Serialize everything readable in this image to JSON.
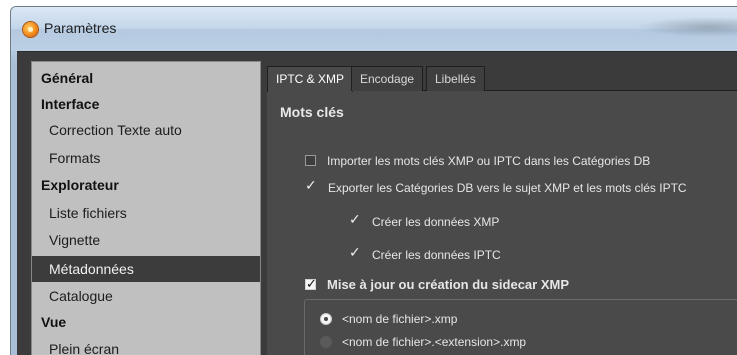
{
  "window": {
    "title": "Paramètres"
  },
  "nav": {
    "items": [
      {
        "label": "Général",
        "type": "head"
      },
      {
        "label": "Interface",
        "type": "head"
      },
      {
        "label": "Correction Texte auto",
        "type": "sub"
      },
      {
        "label": "Formats",
        "type": "sub"
      },
      {
        "label": "Explorateur",
        "type": "head"
      },
      {
        "label": "Liste fichiers",
        "type": "sub"
      },
      {
        "label": "Vignette",
        "type": "sub"
      },
      {
        "label": "Métadonnées",
        "type": "sub",
        "selected": true
      },
      {
        "label": "Catalogue",
        "type": "sub"
      },
      {
        "label": "Vue",
        "type": "head"
      },
      {
        "label": "Plein écran",
        "type": "sub"
      }
    ]
  },
  "tabs": [
    {
      "label": "IPTC & XMP",
      "active": true
    },
    {
      "label": "Encodage",
      "active": false
    },
    {
      "label": "Libellés",
      "active": false
    }
  ],
  "section": {
    "title": "Mots clés"
  },
  "options": {
    "import_keywords": {
      "label": "Importer les mots clés XMP ou IPTC dans les Catégories DB",
      "checked": false
    },
    "export_categories": {
      "label": "Exporter les Catégories DB vers le sujet XMP et les mots clés IPTC",
      "checked": true
    },
    "create_xmp": {
      "label": "Créer les données XMP",
      "checked": true
    },
    "create_iptc": {
      "label": "Créer les données IPTC",
      "checked": true
    },
    "sidecar_update": {
      "label": "Mise à jour ou création du sidecar XMP",
      "checked": true
    }
  },
  "sidecar_naming": {
    "option1": {
      "label": "<nom de fichier>.xmp",
      "selected": true
    },
    "option2": {
      "label": "<nom de fichier>.<extension>.xmp",
      "selected": false
    }
  }
}
